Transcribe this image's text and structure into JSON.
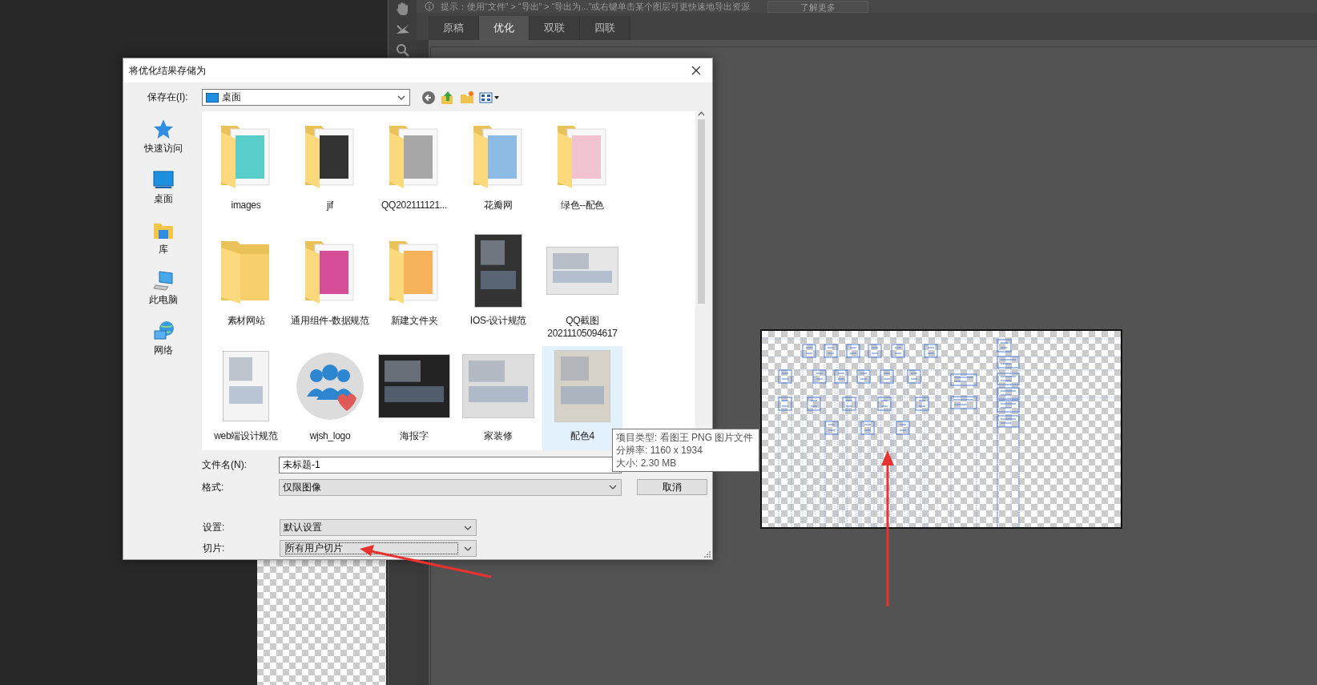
{
  "hint_bar": {
    "text": "提示：使用“文件” > “导出” > “导出为...”或右键单击某个图层可更快速地导出资源",
    "button": "了解更多"
  },
  "tabs": [
    {
      "label": "原稿",
      "selected": false
    },
    {
      "label": "优化",
      "selected": true
    },
    {
      "label": "双联",
      "selected": false
    },
    {
      "label": "四联",
      "selected": false
    }
  ],
  "dialog": {
    "title": "将优化结果存储为",
    "save_in_label": "保存在(I):",
    "location": "桌面",
    "places": [
      {
        "label": "快速访问",
        "kind": "star"
      },
      {
        "label": "桌面",
        "kind": "desktop"
      },
      {
        "label": "库",
        "kind": "library"
      },
      {
        "label": "此电脑",
        "kind": "computer"
      },
      {
        "label": "网络",
        "kind": "network"
      }
    ],
    "files": [
      {
        "name": "images",
        "kind": "folder-preview",
        "selected": false
      },
      {
        "name": "jif",
        "kind": "folder-preview",
        "selected": false
      },
      {
        "name": "QQ202111121...",
        "kind": "folder-preview",
        "selected": false
      },
      {
        "name": "花瓣网",
        "kind": "folder-preview",
        "selected": false
      },
      {
        "name": "绿色--配色",
        "kind": "folder-preview",
        "selected": false
      },
      {
        "name": "素材网站",
        "kind": "folder",
        "selected": false
      },
      {
        "name": "通用组件-数据规范",
        "kind": "folder-preview",
        "selected": false
      },
      {
        "name": "新建文件夹",
        "kind": "folder-preview",
        "selected": false
      },
      {
        "name": "IOS-设计规范",
        "kind": "image",
        "selected": false
      },
      {
        "name": "QQ截图 20211105094617",
        "kind": "image",
        "selected": false
      },
      {
        "name": "web端设计规范",
        "kind": "image",
        "selected": false
      },
      {
        "name": "wjsh_logo",
        "kind": "logo",
        "selected": false
      },
      {
        "name": "海报字",
        "kind": "image",
        "selected": false
      },
      {
        "name": "家装修",
        "kind": "image",
        "selected": false
      },
      {
        "name": "配色4",
        "kind": "image",
        "selected": true
      }
    ],
    "file_name": {
      "label": "文件名(N):",
      "value": "未标题-1"
    },
    "format": {
      "label": "格式:",
      "value": "仅限图像"
    },
    "cancel_button": "取消",
    "settings": {
      "label": "设置:",
      "value": "默认设置"
    },
    "slices": {
      "label": "切片:",
      "value": "所有用户切片",
      "focused": true
    }
  },
  "tooltip": {
    "lines": [
      "项目类型: 看图王 PNG 图片文件",
      "分辨率: 1160 x 1934",
      "大小: 2.30 MB"
    ]
  }
}
